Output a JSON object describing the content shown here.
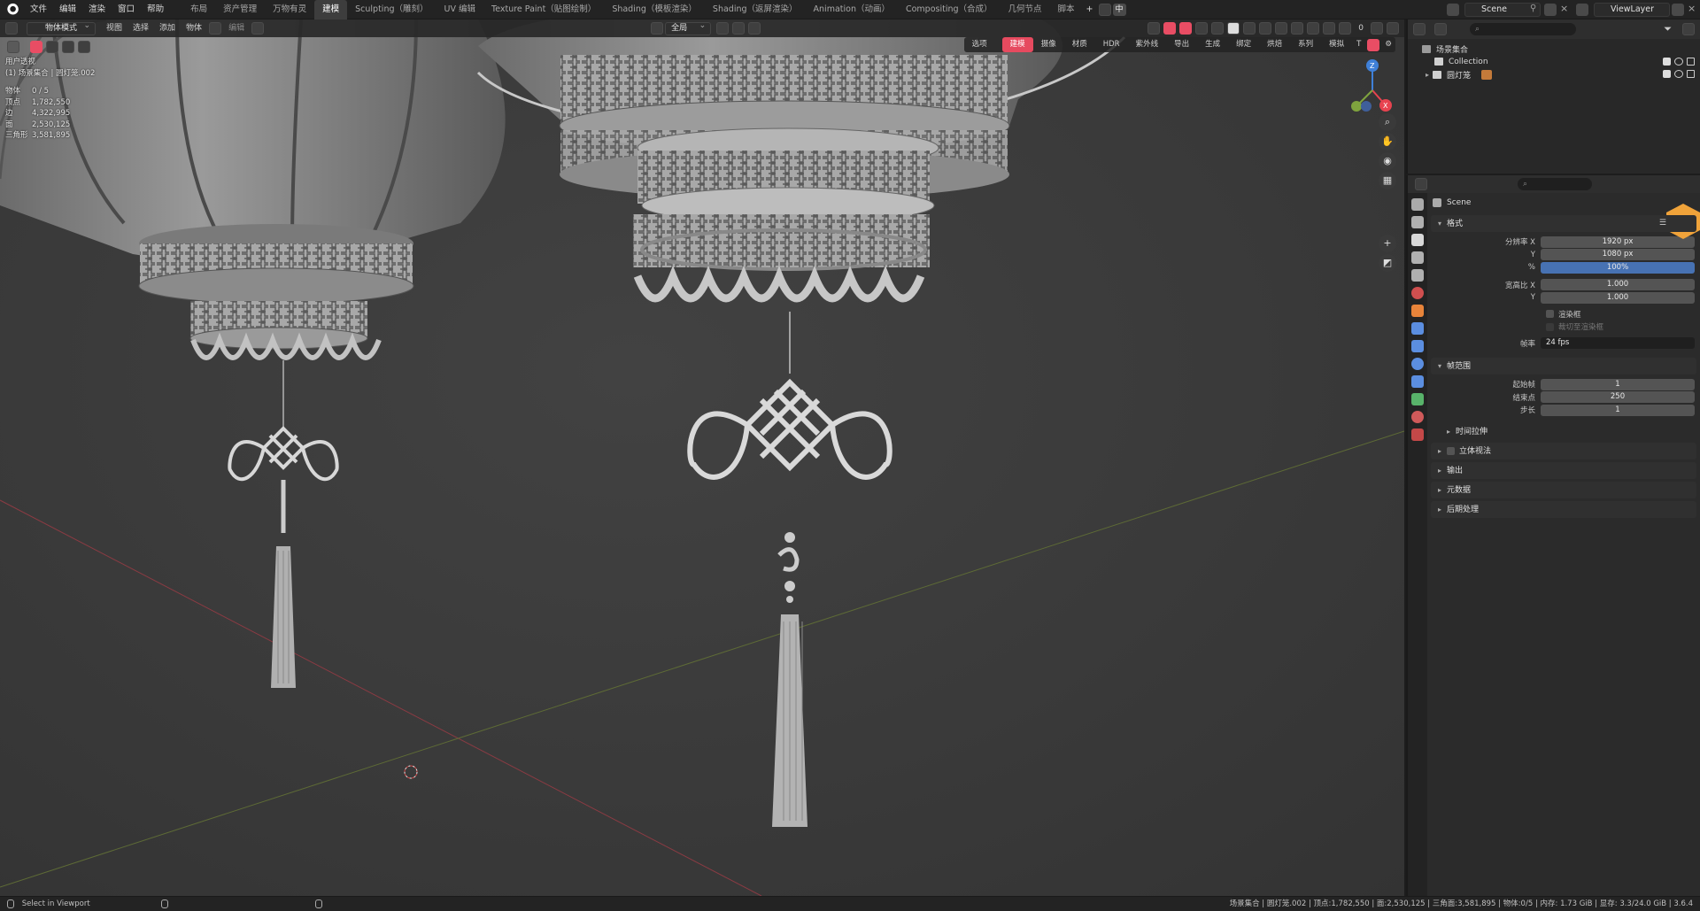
{
  "topbar": {
    "menus": [
      "文件",
      "编辑",
      "渲染",
      "窗口",
      "帮助"
    ],
    "workspaces": [
      "布局",
      "资产管理",
      "万物有灵",
      "建模",
      "Sculpting（雕刻）",
      "UV 编辑",
      "Texture Paint（贴图绘制）",
      "Shading（模板渲染）",
      "Shading（返屏渲染）",
      "Animation（动画）",
      "Compositing（合成）",
      "几何节点",
      "脚本"
    ],
    "active_workspace_index": 3,
    "zh_button": "中",
    "scene_name": "Scene",
    "view_layer": "ViewLayer"
  },
  "viewport": {
    "mode": "物体模式",
    "menus": [
      "视图",
      "选择",
      "添加",
      "物体"
    ],
    "edit_label": "编辑",
    "transform_orientation": "全局",
    "overlay_count": "0",
    "options_label": "选项",
    "tool_tabs": [
      "建模",
      "摄像",
      "材质",
      "HDR",
      "紫外线",
      "导出",
      "生成",
      "绑定",
      "烘焙",
      "系列",
      "模拟"
    ],
    "active_tool_tab": 0,
    "tool_tab_icon": "T",
    "view_name": "用户透视",
    "collection_path": "(1) 场景集合 | 圆灯笼.002",
    "stats": [
      {
        "k": "物体",
        "v": "0 / 5"
      },
      {
        "k": "顶点",
        "v": "1,782,550"
      },
      {
        "k": "边",
        "v": "4,322,995"
      },
      {
        "k": "面",
        "v": "2,530,125"
      },
      {
        "k": "三角形",
        "v": "3,581,895"
      }
    ],
    "gizmo": {
      "z": "Z",
      "x": "X"
    },
    "colors": {
      "x_axis": "#e8434f",
      "y_axis": "#7fa33e",
      "z_axis": "#3f80d8",
      "accent": "#e64a5f"
    }
  },
  "outliner": {
    "rows": [
      {
        "label": "场景集合",
        "indent": 0
      },
      {
        "label": "Collection",
        "indent": 1
      },
      {
        "label": "圆灯笼",
        "indent": 1
      }
    ]
  },
  "properties": {
    "scene_label": "Scene",
    "format_panel": {
      "title": "格式",
      "res_x_label": "分辨率 X",
      "res_x": "1920 px",
      "res_y_label": "Y",
      "res_y": "1080 px",
      "res_pct_label": "%",
      "res_pct": "100%",
      "aspect_x_label": "宽高比 X",
      "aspect_x": "1.000",
      "aspect_y_label": "Y",
      "aspect_y": "1.000",
      "render_region": "渲染框",
      "crop_region": "裁切至渲染框",
      "fps_label": "帧率",
      "fps": "24 fps"
    },
    "frame_panel": {
      "title": "帧范围",
      "start_label": "起始帧",
      "start": "1",
      "end_label": "结束点",
      "end": "250",
      "step_label": "步长",
      "step": "1",
      "time_stretch": "时间拉伸"
    },
    "other_panels": [
      "立体视法",
      "输出",
      "元数据",
      "后期处理"
    ]
  },
  "statusbar": {
    "left": "Select in Viewport",
    "right": "场景集合 | 圆灯笼.002 | 顶点:1,782,550 | 面:2,530,125 | 三角面:3,581,895 | 物体:0/5 | 内存: 1.73 GiB | 显存: 3.3/24.0 GiB | 3.6.4"
  }
}
